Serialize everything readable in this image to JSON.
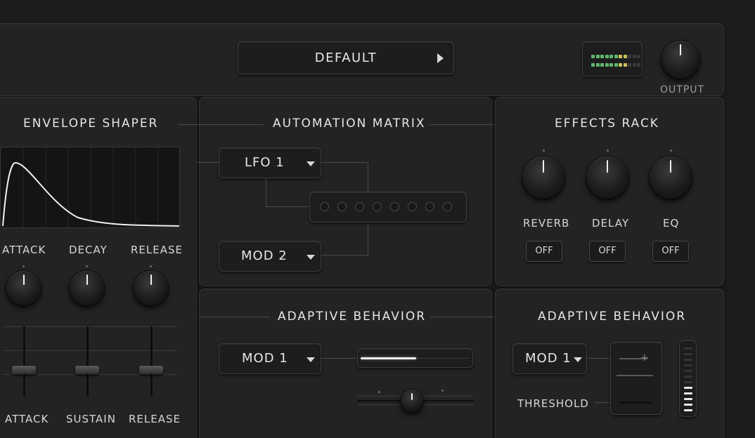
{
  "top": {
    "preset": "DEFAULT",
    "output_label": "OUTPUT"
  },
  "envelope": {
    "title": "ENVELOPE SHAPER",
    "knobs": [
      "ATTACK",
      "DECAY",
      "RELEASE"
    ],
    "faders": [
      "ATTACK",
      "SUSTAIN",
      "RELEASE"
    ]
  },
  "automation": {
    "title": "AUTOMATION MATRIX",
    "source1": "LFO 1",
    "source2": "MOD 2",
    "slot_count": 8
  },
  "effects": {
    "title": "EFFECTS RACK",
    "units": [
      {
        "name": "REVERB",
        "state": "OFF"
      },
      {
        "name": "DELAY",
        "state": "OFF"
      },
      {
        "name": "EQ",
        "state": "OFF"
      }
    ]
  },
  "adaptive_left": {
    "title": "ADAPTIVE BEHAVIOR",
    "source": "MOD 1",
    "amount": 0.5
  },
  "adaptive_right": {
    "title": "ADAPTIVE BEHAVIOR",
    "source": "MOD 1",
    "threshold_label": "THRESHOLD",
    "meter_level": 0.42
  },
  "colors": {
    "meter_green": "#5fb86a",
    "meter_yellow": "#c9c25a"
  },
  "icons": {
    "play": "play-icon",
    "caret": "caret-down-icon"
  }
}
